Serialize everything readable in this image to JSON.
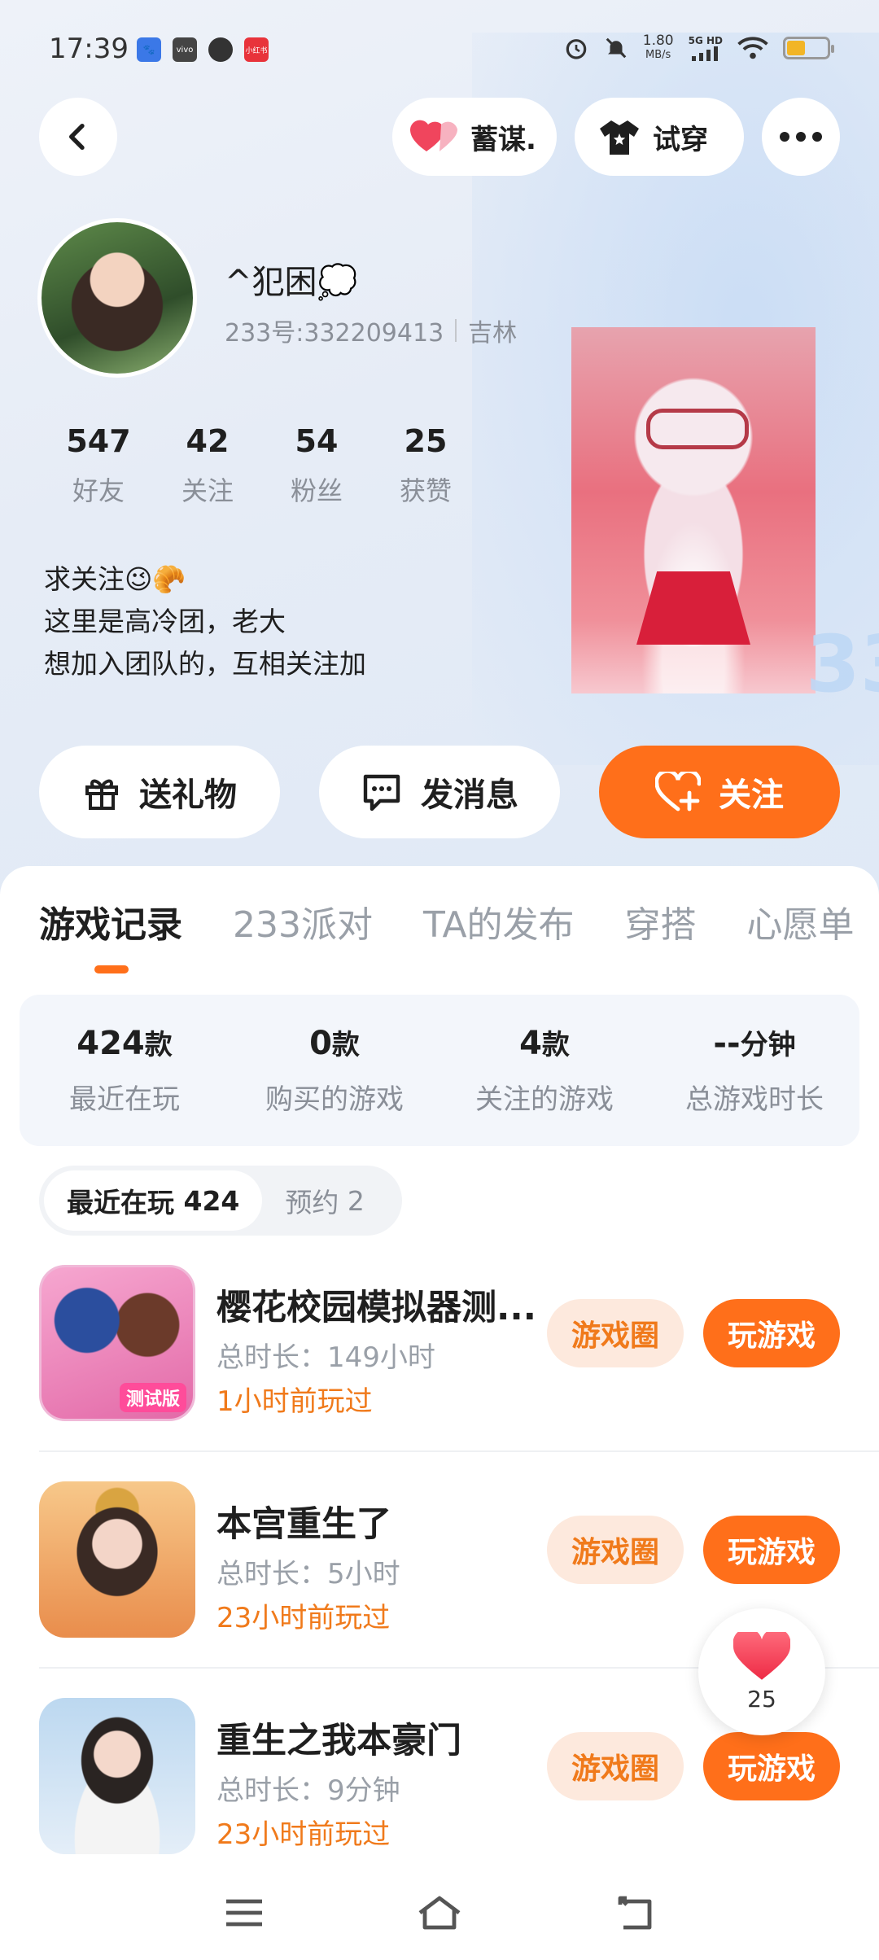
{
  "status_bar": {
    "time": "17:39",
    "net_speed_value": "1.80",
    "net_speed_unit": "MB/s",
    "network": "5G HD",
    "notif_icons": [
      "baidu-icon",
      "vivo-icon",
      "message-icon",
      "app-red-icon"
    ],
    "notif_labels": [
      "",
      "vivo",
      "",
      "小红书"
    ]
  },
  "header": {
    "vote_label": "蓄谋.",
    "tryon_label": "试穿"
  },
  "profile": {
    "nickname": "^犯困💭",
    "id_text": "233号:332209413",
    "location": "吉林",
    "stats": [
      {
        "num": "547",
        "label": "好友"
      },
      {
        "num": "42",
        "label": "关注"
      },
      {
        "num": "54",
        "label": "粉丝"
      },
      {
        "num": "25",
        "label": "获赞"
      }
    ],
    "bio_lines": [
      "求关注😉🥐",
      "这里是高冷团，老大",
      "想加入团队的，互相关注加"
    ]
  },
  "actions": {
    "gift_label": "送礼物",
    "message_label": "发消息",
    "follow_label": "关注"
  },
  "tabs": [
    "游戏记录",
    "233派对",
    "TA的发布",
    "穿搭",
    "心愿单"
  ],
  "summary": [
    {
      "value": "424",
      "unit": "款",
      "label": "最近在玩"
    },
    {
      "value": "0",
      "unit": "款",
      "label": "购买的游戏"
    },
    {
      "value": "4",
      "unit": "款",
      "label": "关注的游戏"
    },
    {
      "value": "--",
      "unit": "分钟",
      "label": "总游戏时长"
    }
  ],
  "subtabs": {
    "recent": "最近在玩",
    "recent_count": "424",
    "reserve": "预约",
    "reserve_count": "2"
  },
  "games": [
    {
      "title": "樱花校园模拟器测...",
      "duration": "总时长：149小时",
      "last_played": "1小时前玩过",
      "circle_label": "游戏圈",
      "play_label": "玩游戏",
      "badge": "测试版"
    },
    {
      "title": "本宫重生了",
      "duration": "总时长：5小时",
      "last_played": "23小时前玩过",
      "circle_label": "游戏圈",
      "play_label": "玩游戏"
    },
    {
      "title": "重生之我本豪门",
      "duration": "总时长：9分钟",
      "last_played": "23小时前玩过",
      "circle_label": "游戏圈",
      "play_label": "玩游戏"
    }
  ],
  "like_float": {
    "count": "25"
  },
  "colors": {
    "accent": "#ff6f1a",
    "accent_light": "#fde9dd",
    "time_text": "#f07a1b"
  }
}
